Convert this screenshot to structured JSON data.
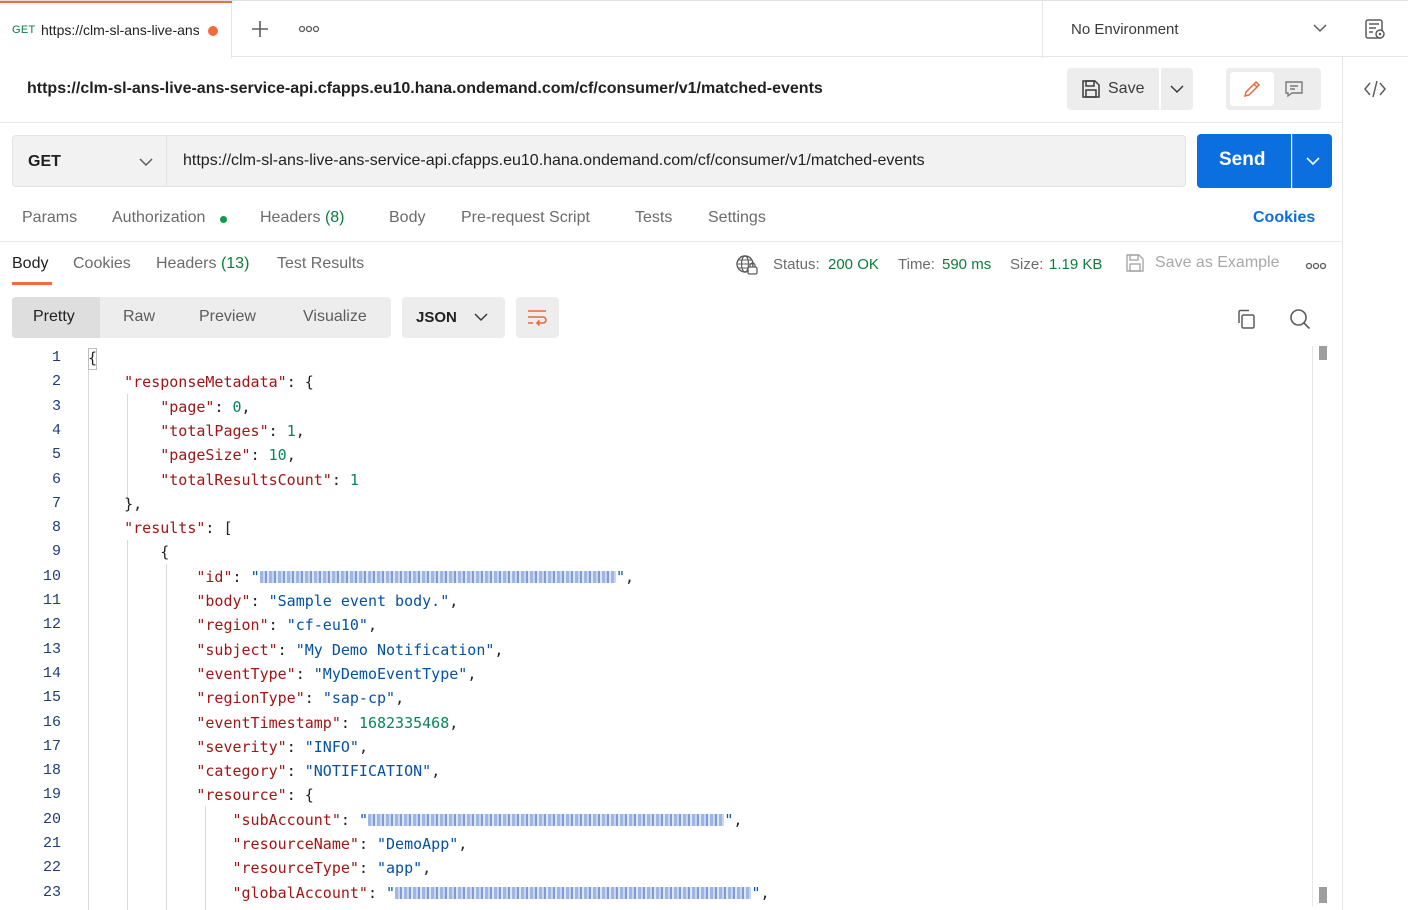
{
  "tab": {
    "method": "GET",
    "url": "https://clm-sl-ans-live-ans-service-api.cfapps.eu10.hana.ondemand.com/cf/consumer/v1/matched-events",
    "unsaved_color": "#f26b3a"
  },
  "environment": {
    "label": "No Environment"
  },
  "request": {
    "title": "https://clm-sl-ans-live-ans-service-api.cfapps.eu10.hana.ondemand.com/cf/consumer/v1/matched-events",
    "save_label": "Save",
    "method": "GET",
    "url": "https://clm-sl-ans-live-ans-service-api.cfapps.eu10.hana.ondemand.com/cf/consumer/v1/matched-events",
    "send_label": "Send",
    "send_color": "#0b6fe0",
    "tabs": [
      {
        "label": "Params"
      },
      {
        "label": "Authorization"
      },
      {
        "label": "Headers",
        "count": "(8)"
      },
      {
        "label": "Body"
      },
      {
        "label": "Pre-request Script"
      },
      {
        "label": "Tests"
      },
      {
        "label": "Settings"
      }
    ],
    "cookies_label": "Cookies"
  },
  "response": {
    "tabs": [
      {
        "label": "Body"
      },
      {
        "label": "Cookies"
      },
      {
        "label": "Headers",
        "count": "(13)"
      },
      {
        "label": "Test Results"
      }
    ],
    "status_key": "Status:",
    "status_value": "200 OK",
    "time_key": "Time:",
    "time_value": "590 ms",
    "size_key": "Size:",
    "size_value": "1.19 KB",
    "save_example_label": "Save as Example",
    "views": [
      "Pretty",
      "Raw",
      "Preview",
      "Visualize"
    ],
    "format": "JSON"
  },
  "code_lines": [
    {
      "n": "1",
      "parts": [
        [
          "p",
          "{"
        ]
      ]
    },
    {
      "n": "2",
      "parts": [
        [
          "p",
          "    "
        ],
        [
          "k",
          "\"responseMetadata\""
        ],
        [
          "p",
          ": {"
        ]
      ]
    },
    {
      "n": "3",
      "parts": [
        [
          "p",
          "        "
        ],
        [
          "k",
          "\"page\""
        ],
        [
          "p",
          ": "
        ],
        [
          "n",
          "0"
        ],
        [
          "p",
          ","
        ]
      ]
    },
    {
      "n": "4",
      "parts": [
        [
          "p",
          "        "
        ],
        [
          "k",
          "\"totalPages\""
        ],
        [
          "p",
          ": "
        ],
        [
          "n",
          "1"
        ],
        [
          "p",
          ","
        ]
      ]
    },
    {
      "n": "5",
      "parts": [
        [
          "p",
          "        "
        ],
        [
          "k",
          "\"pageSize\""
        ],
        [
          "p",
          ": "
        ],
        [
          "n",
          "10"
        ],
        [
          "p",
          ","
        ]
      ]
    },
    {
      "n": "6",
      "parts": [
        [
          "p",
          "        "
        ],
        [
          "k",
          "\"totalResultsCount\""
        ],
        [
          "p",
          ": "
        ],
        [
          "n",
          "1"
        ]
      ]
    },
    {
      "n": "7",
      "parts": [
        [
          "p",
          "    },"
        ]
      ]
    },
    {
      "n": "8",
      "parts": [
        [
          "p",
          "    "
        ],
        [
          "k",
          "\"results\""
        ],
        [
          "p",
          ": ["
        ]
      ]
    },
    {
      "n": "9",
      "parts": [
        [
          "p",
          "        {"
        ]
      ]
    },
    {
      "n": "10",
      "parts": [
        [
          "p",
          "            "
        ],
        [
          "k",
          "\"id\""
        ],
        [
          "p",
          ": "
        ],
        [
          "s",
          "\""
        ],
        [
          "r",
          "36"
        ],
        [
          "s",
          "\""
        ],
        [
          "p",
          ","
        ]
      ]
    },
    {
      "n": "11",
      "parts": [
        [
          "p",
          "            "
        ],
        [
          "k",
          "\"body\""
        ],
        [
          "p",
          ": "
        ],
        [
          "s",
          "\"Sample event body.\""
        ],
        [
          "p",
          ","
        ]
      ]
    },
    {
      "n": "12",
      "parts": [
        [
          "p",
          "            "
        ],
        [
          "k",
          "\"region\""
        ],
        [
          "p",
          ": "
        ],
        [
          "s",
          "\"cf-eu10\""
        ],
        [
          "p",
          ","
        ]
      ]
    },
    {
      "n": "13",
      "parts": [
        [
          "p",
          "            "
        ],
        [
          "k",
          "\"subject\""
        ],
        [
          "p",
          ": "
        ],
        [
          "s",
          "\"My Demo Notification\""
        ],
        [
          "p",
          ","
        ]
      ]
    },
    {
      "n": "14",
      "parts": [
        [
          "p",
          "            "
        ],
        [
          "k",
          "\"eventType\""
        ],
        [
          "p",
          ": "
        ],
        [
          "s",
          "\"MyDemoEventType\""
        ],
        [
          "p",
          ","
        ]
      ]
    },
    {
      "n": "15",
      "parts": [
        [
          "p",
          "            "
        ],
        [
          "k",
          "\"regionType\""
        ],
        [
          "p",
          ": "
        ],
        [
          "s",
          "\"sap-cp\""
        ],
        [
          "p",
          ","
        ]
      ]
    },
    {
      "n": "16",
      "parts": [
        [
          "p",
          "            "
        ],
        [
          "k",
          "\"eventTimestamp\""
        ],
        [
          "p",
          ": "
        ],
        [
          "n",
          "1682335468"
        ],
        [
          "p",
          ","
        ]
      ]
    },
    {
      "n": "17",
      "parts": [
        [
          "p",
          "            "
        ],
        [
          "k",
          "\"severity\""
        ],
        [
          "p",
          ": "
        ],
        [
          "s",
          "\"INFO\""
        ],
        [
          "p",
          ","
        ]
      ]
    },
    {
      "n": "18",
      "parts": [
        [
          "p",
          "            "
        ],
        [
          "k",
          "\"category\""
        ],
        [
          "p",
          ": "
        ],
        [
          "s",
          "\"NOTIFICATION\""
        ],
        [
          "p",
          ","
        ]
      ]
    },
    {
      "n": "19",
      "parts": [
        [
          "p",
          "            "
        ],
        [
          "k",
          "\"resource\""
        ],
        [
          "p",
          ": {"
        ]
      ]
    },
    {
      "n": "20",
      "parts": [
        [
          "p",
          "                "
        ],
        [
          "k",
          "\"subAccount\""
        ],
        [
          "p",
          ": "
        ],
        [
          "s",
          "\""
        ],
        [
          "r",
          "36"
        ],
        [
          "s",
          "\""
        ],
        [
          "p",
          ","
        ]
      ]
    },
    {
      "n": "21",
      "parts": [
        [
          "p",
          "                "
        ],
        [
          "k",
          "\"resourceName\""
        ],
        [
          "p",
          ": "
        ],
        [
          "s",
          "\"DemoApp\""
        ],
        [
          "p",
          ","
        ]
      ]
    },
    {
      "n": "22",
      "parts": [
        [
          "p",
          "                "
        ],
        [
          "k",
          "\"resourceType\""
        ],
        [
          "p",
          ": "
        ],
        [
          "s",
          "\"app\""
        ],
        [
          "p",
          ","
        ]
      ]
    },
    {
      "n": "23",
      "parts": [
        [
          "p",
          "                "
        ],
        [
          "k",
          "\"globalAccount\""
        ],
        [
          "p",
          ": "
        ],
        [
          "s",
          "\""
        ],
        [
          "r",
          "36"
        ],
        [
          "s",
          "\""
        ],
        [
          "p",
          ","
        ]
      ]
    }
  ]
}
